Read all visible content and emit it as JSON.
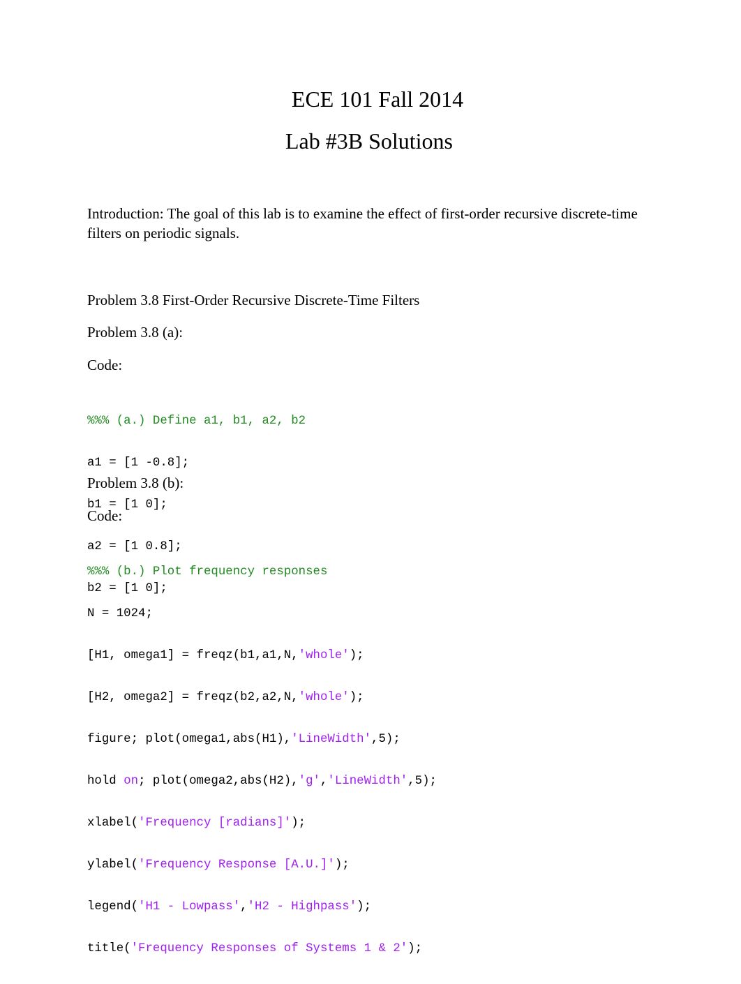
{
  "document": {
    "title": "ECE 101 Fall 2014",
    "subtitle": "Lab #3B Solutions",
    "introduction": "Introduction: The goal of this lab is to examine the effect of first-order recursive discrete-time filters on periodic signals.",
    "section_heading": "Problem 3.8 First-Order Recursive Discrete-Time Filters",
    "parts": [
      {
        "heading": "Problem 3.8 (a):",
        "code_label": "Code:",
        "code": {
          "comment": "%%% (a.) Define a1, b1, a2, b2",
          "lines": [
            "a1 = [1 -0.8];",
            "b1 = [1 0];",
            "a2 = [1 0.8];",
            "b2 = [1 0];"
          ]
        }
      },
      {
        "heading": "Problem 3.8 (b):",
        "code_label": "Code:",
        "code": {
          "comment": "%%% (b.) Plot frequency responses",
          "line_n": "N = 1024;",
          "line_h1": {
            "pre": "[H1, omega1] = freqz(b1,a1,N,",
            "str": "'whole'",
            "post": ");"
          },
          "line_h2": {
            "pre": "[H2, omega2] = freqz(b2,a2,N,",
            "str": "'whole'",
            "post": ");"
          },
          "line_fig": {
            "pre": "figure; plot(omega1,abs(H1),",
            "str": "'LineWidth'",
            "post": ",5);"
          },
          "line_hold": {
            "kw_pre": "hold ",
            "kw": "on",
            "mid": "; plot(omega2,abs(H2),",
            "str1": "'g'",
            "sep": ",",
            "str2": "'LineWidth'",
            "post": ",5);"
          },
          "line_xlabel": {
            "pre": "xlabel(",
            "str": "'Frequency [radians]'",
            "post": ");"
          },
          "line_ylabel": {
            "pre": "ylabel(",
            "str": "'Frequency Response [A.U.]'",
            "post": ");"
          },
          "line_legend": {
            "pre": "legend(",
            "str1": "'H1 - Lowpass'",
            "sep": ",",
            "str2": "'H2 - Highpass'",
            "post": ");"
          },
          "line_title": {
            "pre": "title(",
            "str": "'Frequency Responses of Systems 1 & 2'",
            "post": ");"
          }
        }
      }
    ]
  },
  "colors": {
    "comment": "#228b22",
    "string": "#a020f0",
    "keyword": "#a020f0",
    "text": "#000000"
  }
}
